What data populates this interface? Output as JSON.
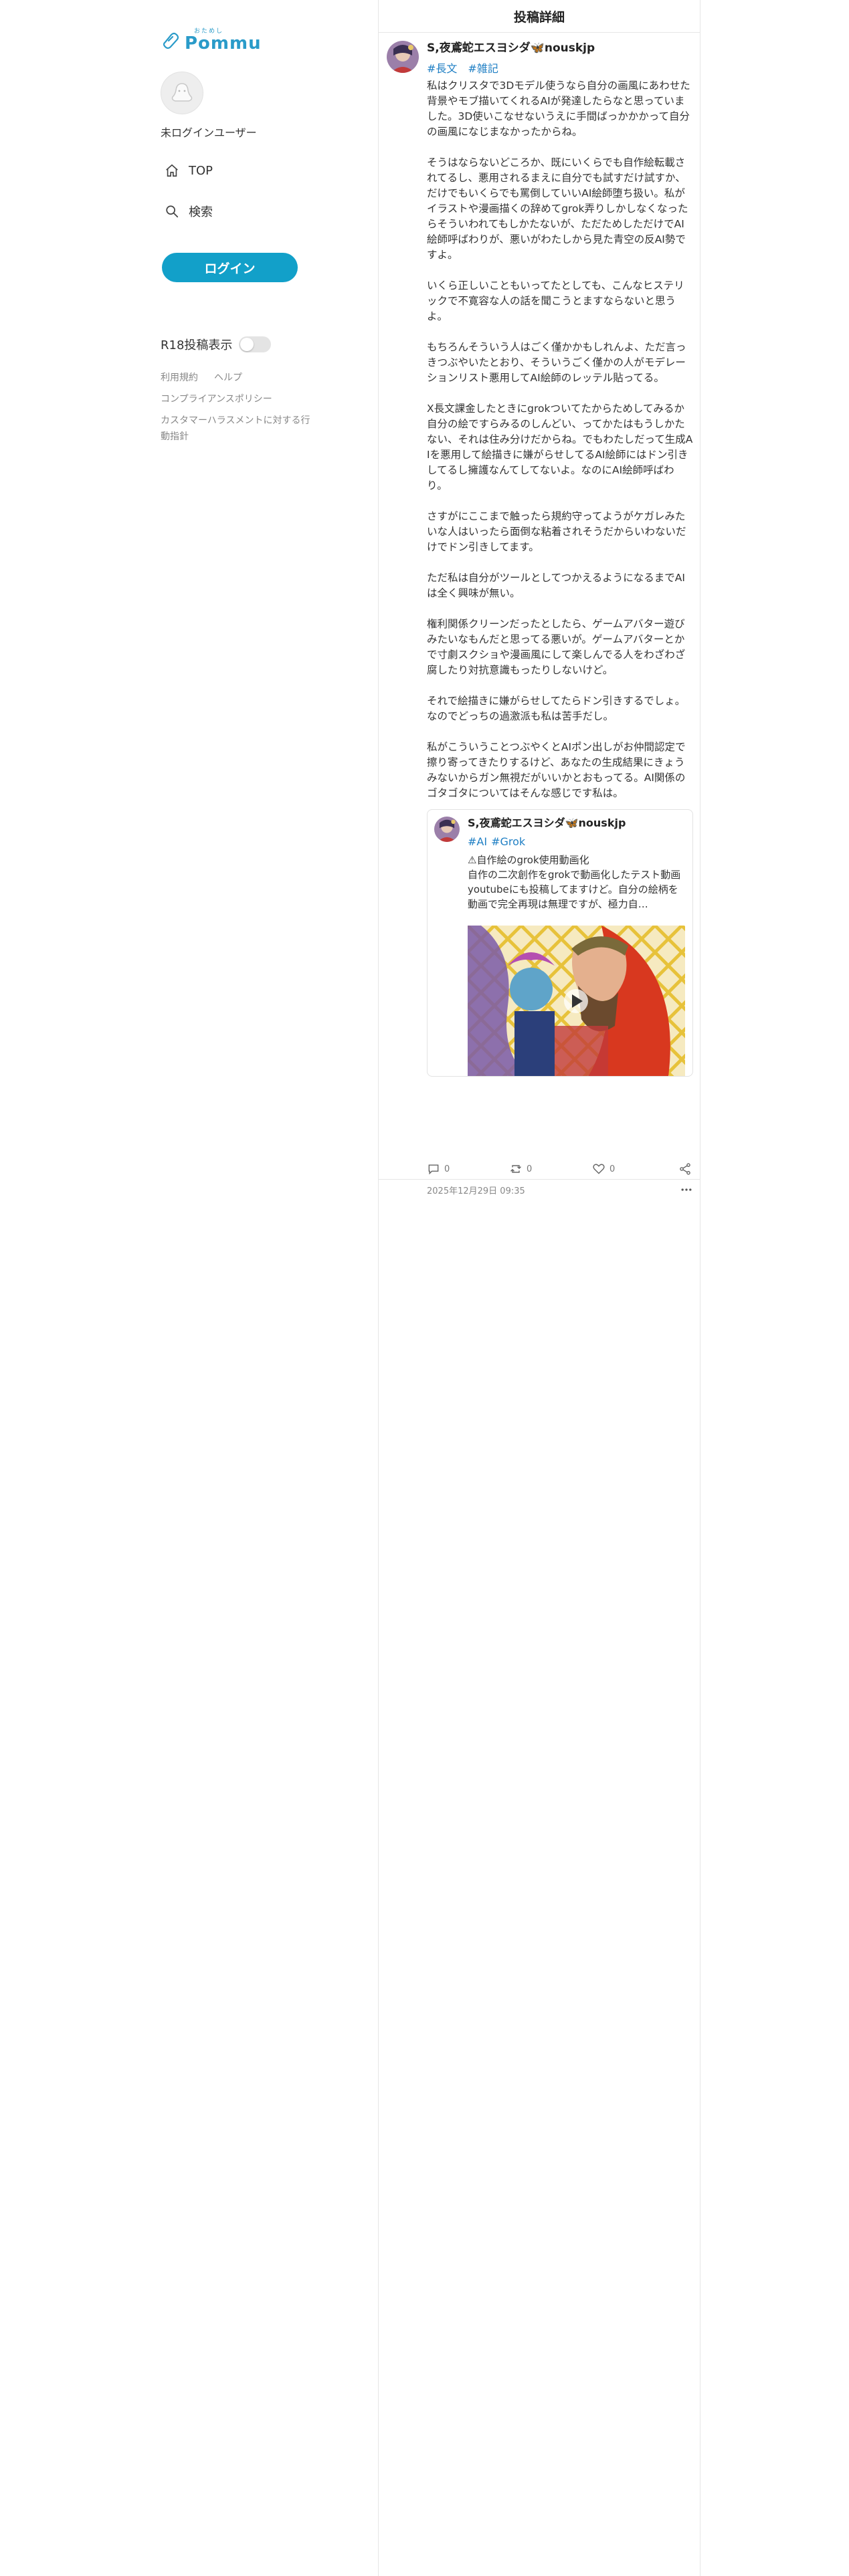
{
  "sidebar": {
    "logo": {
      "sub": "おためし",
      "main": "Pommu"
    },
    "user_name": "未ログインユーザー",
    "nav": [
      {
        "label": "TOP",
        "icon": "home-icon"
      },
      {
        "label": "検索",
        "icon": "search-icon"
      }
    ],
    "login_label": "ログイン",
    "r18_label": "R18投稿表示",
    "r18_enabled": false,
    "footer": {
      "terms": "利用規約",
      "help": "ヘルプ",
      "compliance": "コンプライアンスポリシー",
      "harassment": "カスタマーハラスメントに対する行動指針"
    }
  },
  "colors": {
    "accent": "#12a0c9",
    "tag": "#1f7fc4",
    "border": "#e6e6e6"
  },
  "main": {
    "header_title": "投稿詳細",
    "post": {
      "author": "S,夜鳶蛇エスヨシダ🦋nouskjp",
      "tags": [
        "#長文",
        "#雑記"
      ],
      "content": "私はクリスタで3Dモデル使うなら自分の画風にあわせた背景やモブ描いてくれるAIが発達したらなと思っていました。3D使いこなせないうえに手間ばっかかかって自分の画風になじまなかったからね。\n\nそうはならないどころか、既にいくらでも自作絵転載されてるし、悪用されるまえに自分でも試すだけ試すか、だけでもいくらでも罵倒していいAI絵師堕ち扱い。私がイラストや漫画描くの辞めてgrok弄りしかしなくなったらそういわれてもしかたないが、ただためしただけでAI絵師呼ばわりが、悪いがわたしから見た青空の反AI勢ですよ。\n\nいくら正しいこともいってたとしても、こんなヒステリックで不寛容な人の話を聞こうとますならないと思うよ。\n\nもちろんそういう人はごく僅かかもしれんよ、ただ言っきつぶやいたとおり、そういうごく僅かの人がモデレーションリスト悪用してAI絵師のレッテル貼ってる。\n\nX長文課金したときにgrokついてたからためしてみるか自分の絵ですらみるのしんどい、ってかたはもうしかたない、それは住み分けだからね。でもわたしだって生成AIを悪用して絵描きに嫌がらせしてるAI絵師にはドン引きしてるし擁護なんてしてないよ。なのにAI絵師呼ばわり。\n\nさすがにここまで触ったら規約守ってようがケガレみたいな人はいったら面倒な粘着されそうだからいわないだけでドン引きしてます。\n\nただ私は自分がツールとしてつかえるようになるまでAIは全く興味が無い。\n\n権利関係クリーンだったとしたら、ゲームアバター遊びみたいなもんだと思ってる悪いが。ゲームアバターとかで寸劇スクショや漫画風にして楽しんでる人をわざわざ腐したり対抗意識もったりしないけど。\n\nそれで絵描きに嫌がらせしてたらドン引きするでしょ。なのでどっちの過激派も私は苦手だし。\n\n私がこういうことつぶやくとAIポン出しがお仲間認定で擦り寄ってきたりするけど、あなたの生成結果にきょうみないからガン無視だがいいかとおもってる。AI関係のゴタゴタについてはそんな感じです私は。",
      "quote": {
        "author": "S,夜鳶蛇エスヨシダ🦋nouskjp",
        "tags": [
          "#AI",
          "#Grok"
        ],
        "text": "⚠自作絵のgrok使用動画化\n自作の二次創作をgrokで動画化したテスト動画youtubeにも投稿してますけど。自分の絵柄を動画で完全再現は無理ですが、極力自…"
      },
      "counts": {
        "replies": "0",
        "reposts": "0",
        "likes": "0"
      },
      "timestamp": "2025年12月29日 09:35"
    }
  }
}
